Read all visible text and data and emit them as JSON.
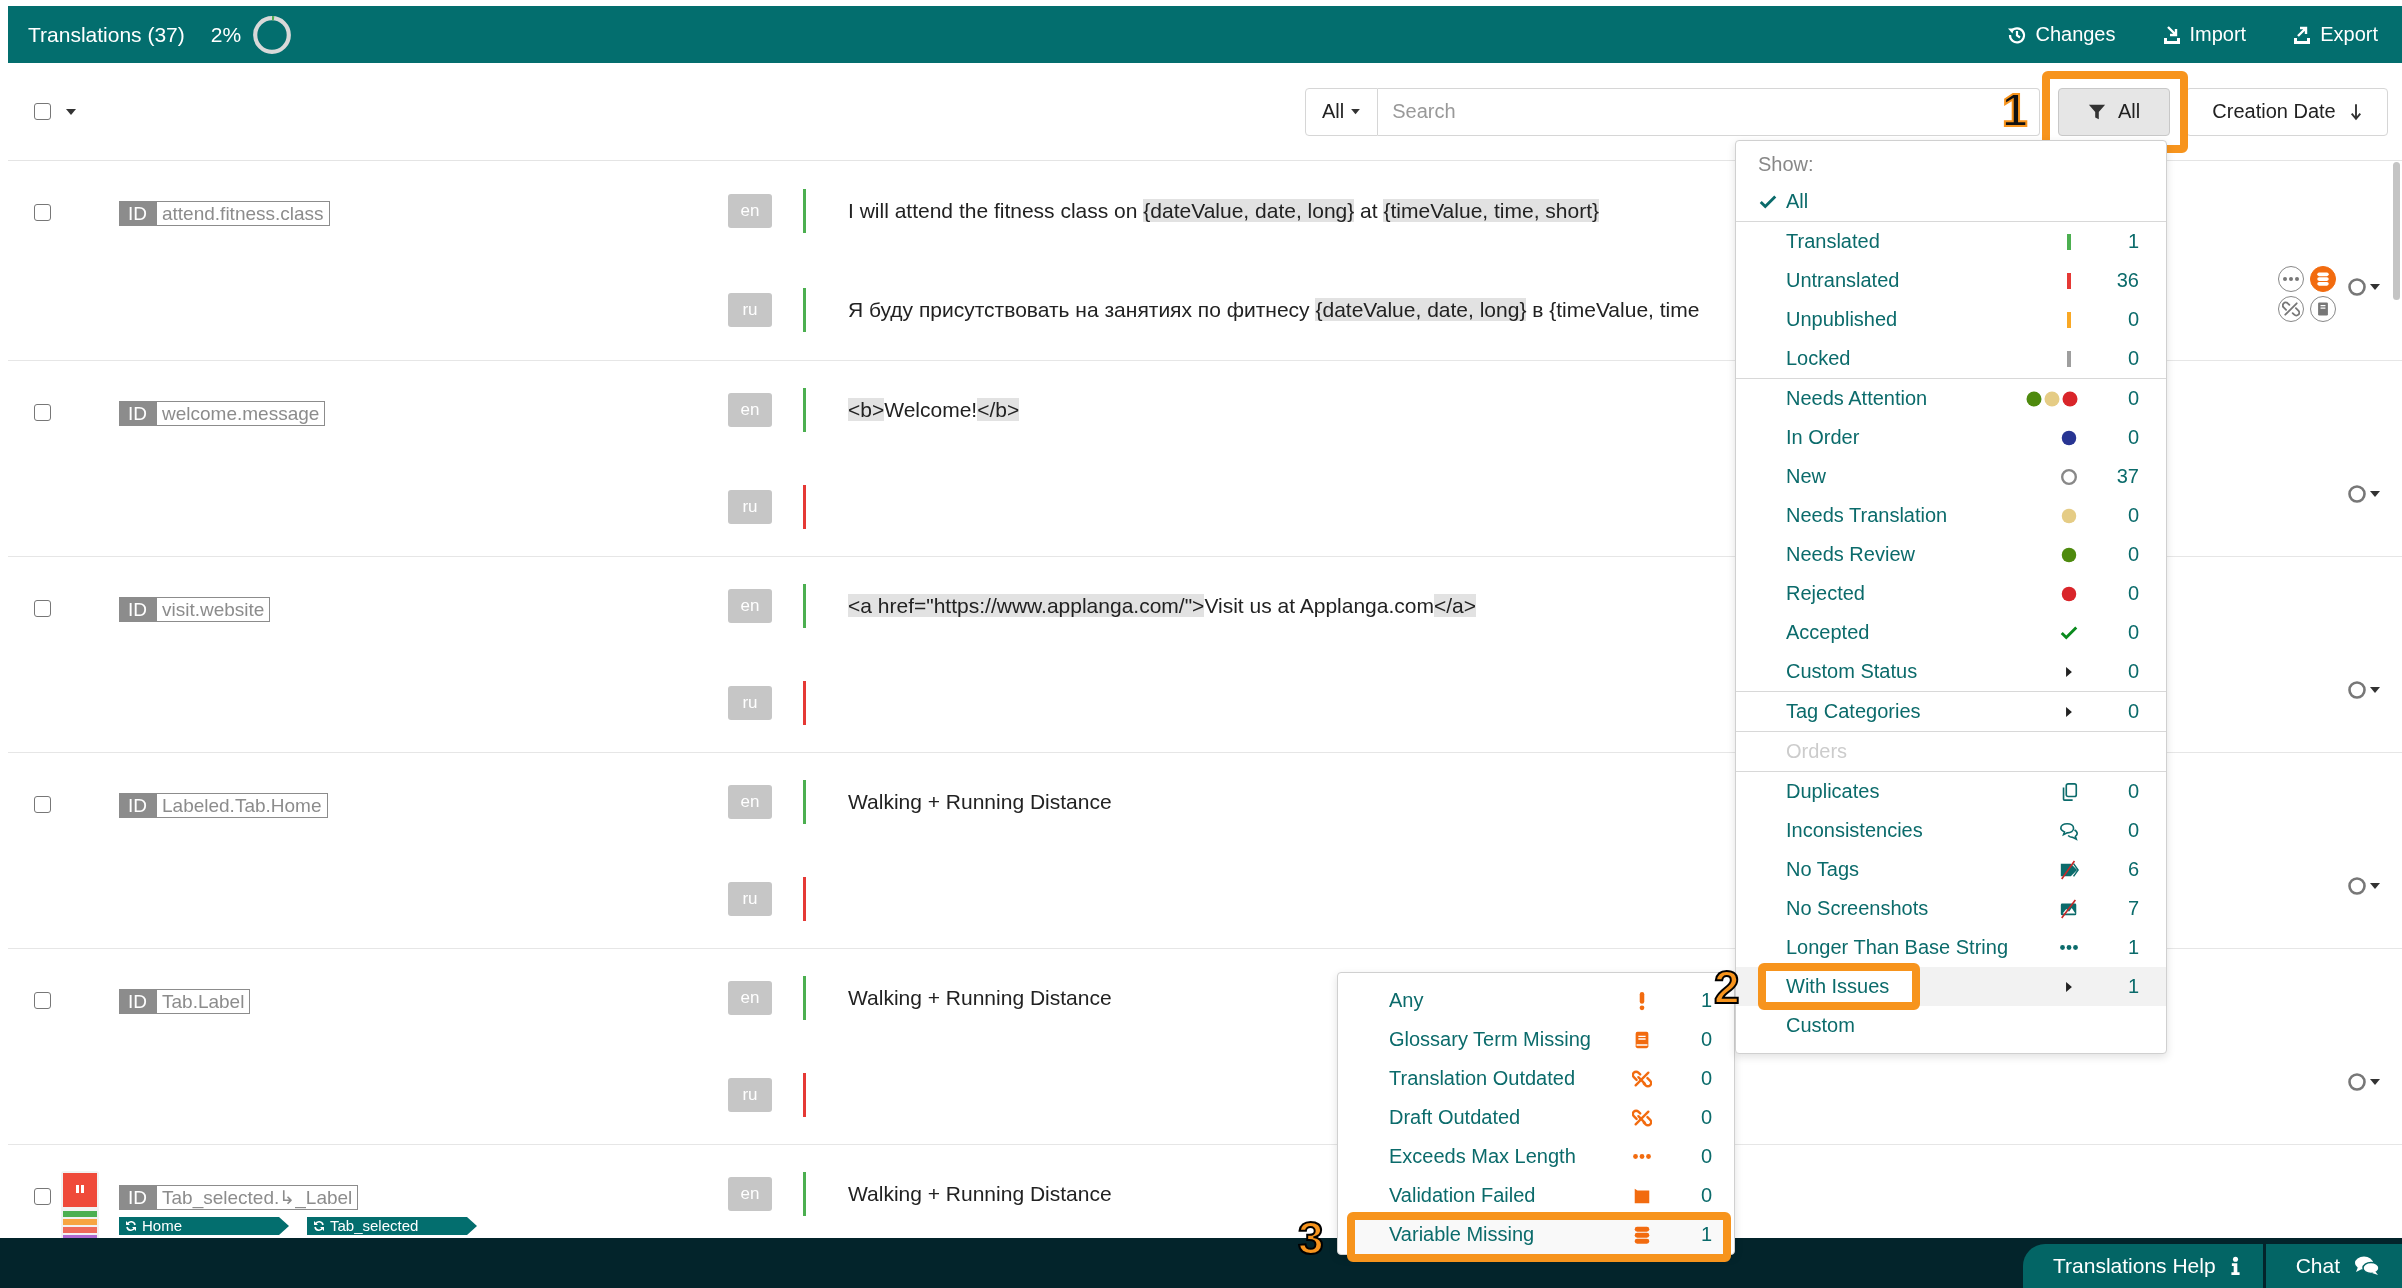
{
  "header": {
    "title": "Translations (37)",
    "progress": {
      "text": "2%",
      "level": 0.02
    },
    "actions": [
      {
        "label": "Changes",
        "kind": "history"
      },
      {
        "label": "Import",
        "kind": "import"
      },
      {
        "label": "Export",
        "kind": "export"
      }
    ]
  },
  "toolbar": {
    "select_all": {
      "checked": false
    },
    "scope": "All",
    "search": {
      "placeholder": "Search"
    },
    "filter": {
      "label": "All",
      "callout": "1"
    },
    "sort": {
      "label": "Creation Date"
    }
  },
  "rows": [
    {
      "checked": false,
      "id_label": "ID",
      "key": "attend.fitness.class",
      "status_dropdown": true,
      "issue_icons": [
        {
          "kind": "longer"
        },
        {
          "kind": "variable"
        },
        {
          "kind": "outdated"
        },
        {
          "kind": "glossary"
        }
      ],
      "translations": [
        {
          "lang": "en",
          "translated": true,
          "segments": [
            {
              "text": "I will attend the fitness class on ",
              "highlighted": false
            },
            {
              "text": "{dateValue, date, long}",
              "highlighted": true
            },
            {
              "text": " at ",
              "highlighted": false
            },
            {
              "text": "{timeValue, time, short}",
              "highlighted": true
            }
          ]
        },
        {
          "lang": "ru",
          "translated": true,
          "segments": [
            {
              "text": "Я буду присутствовать на занятиях по фитнесу ",
              "highlighted": false
            },
            {
              "text": "{dateValue, date, long}",
              "highlighted": true
            },
            {
              "text": " в {timeValue, time",
              "highlighted": false
            }
          ]
        }
      ]
    },
    {
      "checked": false,
      "id_label": "ID",
      "key": "welcome.message",
      "status_dropdown": true,
      "translations": [
        {
          "lang": "en",
          "translated": true,
          "segments": [
            {
              "text": "<b>",
              "highlighted": true
            },
            {
              "text": "Welcome!",
              "highlighted": false
            },
            {
              "text": "</b>",
              "highlighted": true
            }
          ]
        },
        {
          "lang": "ru",
          "translated": false
        }
      ]
    },
    {
      "checked": false,
      "id_label": "ID",
      "key": "visit.website",
      "status_dropdown": true,
      "translations": [
        {
          "lang": "en",
          "translated": true,
          "segments": [
            {
              "text": "<a href=\"https://www.applanga.com/\">",
              "highlighted": true
            },
            {
              "text": "Visit us at Applanga.com",
              "highlighted": false
            },
            {
              "text": "</a>",
              "highlighted": true
            }
          ]
        },
        {
          "lang": "ru",
          "translated": false
        }
      ]
    },
    {
      "checked": false,
      "id_label": "ID",
      "key": "Labeled.Tab.Home",
      "status_dropdown": true,
      "translations": [
        {
          "lang": "en",
          "translated": true,
          "segments": [
            {
              "text": "Walking + Running Distance",
              "highlighted": false
            }
          ]
        },
        {
          "lang": "ru",
          "translated": false
        }
      ]
    },
    {
      "checked": false,
      "id_label": "ID",
      "key": "Tab.Label",
      "status_dropdown": true,
      "translations": [
        {
          "lang": "en",
          "translated": true,
          "segments": [
            {
              "text": "Walking + Running Distance",
              "highlighted": false
            }
          ]
        },
        {
          "lang": "ru",
          "translated": false
        }
      ]
    },
    {
      "checked": false,
      "id_label": "ID",
      "key": "Tab_selected.↳_Label",
      "screenshot": {
        "kind": "picture"
      },
      "tags": [
        "Home",
        "Tab_selected"
      ],
      "translations": [
        {
          "lang": "en",
          "translated": true,
          "segments": [
            {
              "text": "Walking + Running Distance",
              "highlighted": false
            }
          ]
        }
      ]
    }
  ],
  "filter_menu": {
    "sections": [
      {
        "heading": "Show:",
        "items": [
          {
            "label": "All",
            "selected": true,
            "expanded": false,
            "disabled": false
          }
        ]
      },
      {
        "items": [
          {
            "label": "Translated",
            "count": "1",
            "selected": false,
            "expanded": false,
            "disabled": false,
            "marker": {
              "kind": "bar",
              "color": "#4caf50"
            }
          },
          {
            "label": "Untranslated",
            "count": "36",
            "selected": false,
            "expanded": false,
            "disabled": false,
            "marker": {
              "kind": "bar",
              "color": "#e53935"
            }
          },
          {
            "label": "Unpublished",
            "count": "0",
            "selected": false,
            "expanded": false,
            "disabled": false,
            "marker": {
              "kind": "bar",
              "color": "#f9a825"
            }
          },
          {
            "label": "Locked",
            "count": "0",
            "selected": false,
            "expanded": false,
            "disabled": false,
            "marker": {
              "kind": "bar",
              "color": "#9e9e9e"
            }
          }
        ]
      },
      {
        "items": [
          {
            "label": "Needs Attention",
            "count": "0",
            "selected": false,
            "expanded": false,
            "disabled": false,
            "marker": {
              "kind": "dots",
              "dots": [
                {
                  "color": "#4e8a0e"
                },
                {
                  "color": "#e5cc85"
                },
                {
                  "color": "#d9252a"
                }
              ]
            }
          },
          {
            "label": "In Order",
            "count": "0",
            "selected": false,
            "expanded": false,
            "disabled": false,
            "marker": {
              "kind": "dot",
              "color": "#283593"
            }
          },
          {
            "label": "New",
            "count": "37",
            "selected": false,
            "expanded": false,
            "disabled": false,
            "marker": {
              "kind": "ring"
            }
          },
          {
            "label": "Needs Translation",
            "count": "0",
            "selected": false,
            "expanded": false,
            "disabled": false,
            "marker": {
              "kind": "dot",
              "color": "#e5cc85"
            }
          },
          {
            "label": "Needs Review",
            "count": "0",
            "selected": false,
            "expanded": false,
            "disabled": false,
            "marker": {
              "kind": "dot",
              "color": "#4e8a0e"
            }
          },
          {
            "label": "Rejected",
            "count": "0",
            "selected": false,
            "expanded": false,
            "disabled": false,
            "marker": {
              "kind": "dot",
              "color": "#d9252a"
            }
          },
          {
            "label": "Accepted",
            "count": "0",
            "selected": false,
            "expanded": false,
            "disabled": false,
            "marker": {
              "kind": "check"
            }
          },
          {
            "label": "Custom Status",
            "count": "0",
            "selected": false,
            "expanded": false,
            "disabled": false,
            "marker": {
              "kind": "arrow"
            }
          }
        ]
      },
      {
        "items": [
          {
            "label": "Tag Categories",
            "count": "0",
            "selected": false,
            "expanded": false,
            "disabled": false,
            "marker": {
              "kind": "arrow"
            }
          }
        ]
      },
      {
        "items": [
          {
            "label": "Orders",
            "selected": false,
            "expanded": false,
            "disabled": true
          }
        ]
      },
      {
        "items": [
          {
            "label": "Duplicates",
            "count": "0",
            "selected": false,
            "expanded": false,
            "disabled": false,
            "marker": {
              "kind": "duplicates"
            }
          },
          {
            "label": "Inconsistencies",
            "count": "0",
            "selected": false,
            "expanded": false,
            "disabled": false,
            "marker": {
              "kind": "inconsistencies"
            }
          },
          {
            "label": "No Tags",
            "count": "6",
            "selected": false,
            "expanded": false,
            "disabled": false,
            "marker": {
              "kind": "no_tags"
            }
          },
          {
            "label": "No Screenshots",
            "count": "7",
            "selected": false,
            "expanded": false,
            "disabled": false,
            "marker": {
              "kind": "no_screenshots"
            }
          },
          {
            "label": "Longer Than Base String",
            "count": "1",
            "selected": false,
            "expanded": false,
            "disabled": false,
            "marker": {
              "kind": "longer"
            }
          },
          {
            "label": "With Issues",
            "count": "1",
            "selected": false,
            "expanded": true,
            "disabled": false,
            "callout": "2",
            "marker": {
              "kind": "arrow"
            }
          },
          {
            "label": "Custom",
            "selected": false,
            "expanded": false,
            "disabled": false
          }
        ]
      }
    ]
  },
  "issues_submenu": {
    "items": [
      {
        "label": "Any",
        "count": "1",
        "marker": {
          "kind": "any"
        }
      },
      {
        "label": "Glossary Term Missing",
        "count": "0",
        "marker": {
          "kind": "glossary"
        }
      },
      {
        "label": "Translation Outdated",
        "count": "0",
        "marker": {
          "kind": "outdated"
        }
      },
      {
        "label": "Draft Outdated",
        "count": "0",
        "marker": {
          "kind": "outdated"
        }
      },
      {
        "label": "Exceeds Max Length",
        "count": "0",
        "marker": {
          "kind": "exceeds"
        }
      },
      {
        "label": "Validation Failed",
        "count": "0",
        "marker": {
          "kind": "validation"
        }
      },
      {
        "label": "Variable Missing",
        "count": "1",
        "callout": "3",
        "marker": {
          "kind": "variable"
        }
      }
    ]
  },
  "footer": {
    "buttons": [
      {
        "label": "Translations Help",
        "kind": "info"
      },
      {
        "label": "Chat",
        "kind": "chat"
      }
    ]
  }
}
